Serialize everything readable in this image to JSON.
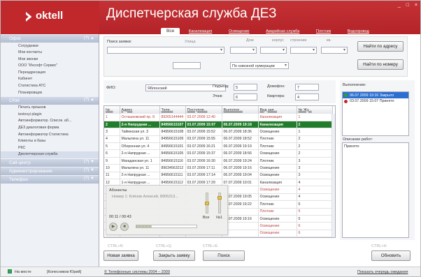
{
  "app": {
    "logo_text": "oktell",
    "title": "Диспетчерская служба ДЕЗ",
    "win_controls": [
      "_",
      "□",
      "×"
    ]
  },
  "tabs": [
    "Все",
    "Канализация",
    "Освещение",
    "Аварийная служба",
    "Плотник",
    "Водопровод"
  ],
  "sidebar": {
    "sections": [
      {
        "label": "Офис",
        "ctl": "(?) ▲",
        "items": [
          "Сотрудники",
          "Мои контакты",
          "Мои звонки",
          "ООО \"Инсофт Сервис\"",
          "Переадресация",
          "Кабинет",
          "Статистика АТС",
          "Планировщик"
        ]
      },
      {
        "label": "CRM",
        "ctl": "(?) ▲",
        "items": [
          "Печать ярлыков",
          "testovyi plagin",
          "Автоинформатор. Список. аб...",
          "ДЕЗ диалоговая форма",
          "Автоинформатор Статистика",
          "Клиенты и базы",
          "РКС",
          "Диспетчерская служба"
        ]
      },
      {
        "label": "Call-центр",
        "ctl": "(?) ▼"
      },
      {
        "label": "Администрирование",
        "ctl": "(?) ▼"
      },
      {
        "label": "Телефон",
        "ctl": "(?) ▼"
      }
    ]
  },
  "filter": {
    "search_label": "Поиск заявки:",
    "street": "Улица",
    "house": "Дом",
    "korpus": "корпус",
    "stroenie": "строение",
    "kv": "кв.",
    "numbering": "По сквозной нумерации",
    "btn_address": "Найти по адресу",
    "btn_number": "Найти по номеру"
  },
  "person": {
    "fio_label": "ФИО:",
    "fio": "Яблонский",
    "podezd_label": "Подъезд:",
    "podezd": "5",
    "domofon_label": "Домофон:",
    "domofon": "7",
    "etazh_label": "Этаж:",
    "etazh": "6",
    "kvartira_label": "Квартира:",
    "kvartira": "4"
  },
  "grid": {
    "columns": [
      "№...",
      "Адрес",
      "Теле...",
      "Поступле...",
      "Выполне...",
      "Вид зая...",
      "№ Жу..."
    ],
    "rows": [
      {
        "c": [
          "1",
          "Осташковский пр. 8",
          "89265144444",
          "03.07.2009 12:40",
          "",
          "Канализация",
          "1"
        ],
        "cls": "dim"
      },
      {
        "c": [
          "2",
          "2-я Напрудная ...",
          "84956615107",
          "03.07.2009 15:07",
          "06.07.2009 19:16",
          "Канализация",
          "2"
        ],
        "cls": "sel"
      },
      {
        "c": [
          "3",
          "Таймнская ул. 3",
          "84956615108",
          "03.07.2009 15:52",
          "06.07.2009 18:36",
          "Освещение",
          "1"
        ]
      },
      {
        "c": [
          "4",
          "Малыгина ул. 11",
          "84956615109",
          "03.07.2009 15:55",
          "06.07.2009 18:52",
          "Плотник",
          "2"
        ]
      },
      {
        "c": [
          "5",
          "Оборонная ул. 4",
          "84956615101",
          "03.07.2009 16:21",
          "06.07.2009 19:19",
          "Плотник",
          "2"
        ]
      },
      {
        "c": [
          "6",
          "2-я Напрудная ...",
          "84956615105",
          "03.07.2009 15:37",
          "06.07.2009 18:56",
          "Освещение",
          "2"
        ]
      },
      {
        "c": [
          "9",
          "Магаданская ул. 1",
          "84956615116",
          "03.07.2009 16:30",
          "06.07.2009 19:24",
          "Плотник",
          "3"
        ]
      },
      {
        "c": [
          "10",
          "Малыгина ул. 11",
          "89034563212",
          "03.07.2009 17:11",
          "06.07.2009 19:16",
          "Освещение",
          "3"
        ]
      },
      {
        "c": [
          "11",
          "2-я Напрудная ...",
          "84956615111",
          "03.07.2009 17:14",
          "06.07.2009 19:04",
          "Освещение",
          "3"
        ]
      },
      {
        "c": [
          "12",
          "1-я Напрудная ...",
          "84956615112",
          "03.07.2009 17:29",
          "07.07.2009 10:01",
          "Канализация",
          "4"
        ]
      },
      {
        "c": [
          "",
          "",
          "",
          "",
          "",
          "Освещение",
          "4"
        ],
        "cls": "dimr"
      },
      {
        "c": [
          "",
          "",
          "",
          "",
          "06.07.2009 19:05",
          "Освещение",
          "4"
        ]
      },
      {
        "c": [
          "",
          "",
          "",
          "",
          "06.07.2009 19:22",
          "Плотник",
          "5"
        ]
      },
      {
        "c": [
          "",
          "",
          "",
          "",
          "",
          "Плотник",
          "5"
        ],
        "cls": "dimr"
      },
      {
        "c": [
          "",
          "",
          "",
          "",
          "06.07.2009 19:16",
          "Освещение",
          "5"
        ]
      },
      {
        "c": [
          "",
          "",
          "",
          "",
          "",
          "Освещение",
          "6"
        ],
        "cls": "dimr"
      },
      {
        "c": [
          "",
          "",
          "",
          "",
          "",
          "Освещение",
          "6"
        ],
        "cls": "dimr"
      }
    ]
  },
  "player": {
    "title": "Абоненты",
    "subtitle": "Номер 1:  Клёнов Алексей, 8905313...",
    "time": "00:11 / 00:43",
    "all": "Все",
    "n1": "№1",
    "progress": 0.26,
    "play_glyph": "▶",
    "stop_glyph": "■"
  },
  "right": {
    "exec_label": "Выполнение:",
    "exec_items": [
      {
        "text": "06.07.2009 19:16 Закрыто",
        "color": "#2aa52a"
      },
      {
        "text": "03.07.2009 15:07 Принято",
        "color": "#c0282c"
      }
    ],
    "desc_label": "Описание работ:",
    "desc": "Принято"
  },
  "bottom": {
    "hint_n": "CTRL+N",
    "hint_q": "CTRL+Q",
    "hint_e": "CTRL+E",
    "hint_h": "CTRL+H",
    "btn_new": "Новая заявка",
    "btn_close": "Закрыть заявку",
    "btn_search": "Поиск",
    "btn_exec": "Обновить"
  },
  "status": {
    "presence": "На месте",
    "user": "[Колесников Юрий]",
    "copyright": "© Телефонные системы 2004 – 2009",
    "queue": "Показать очередь ожидания"
  }
}
